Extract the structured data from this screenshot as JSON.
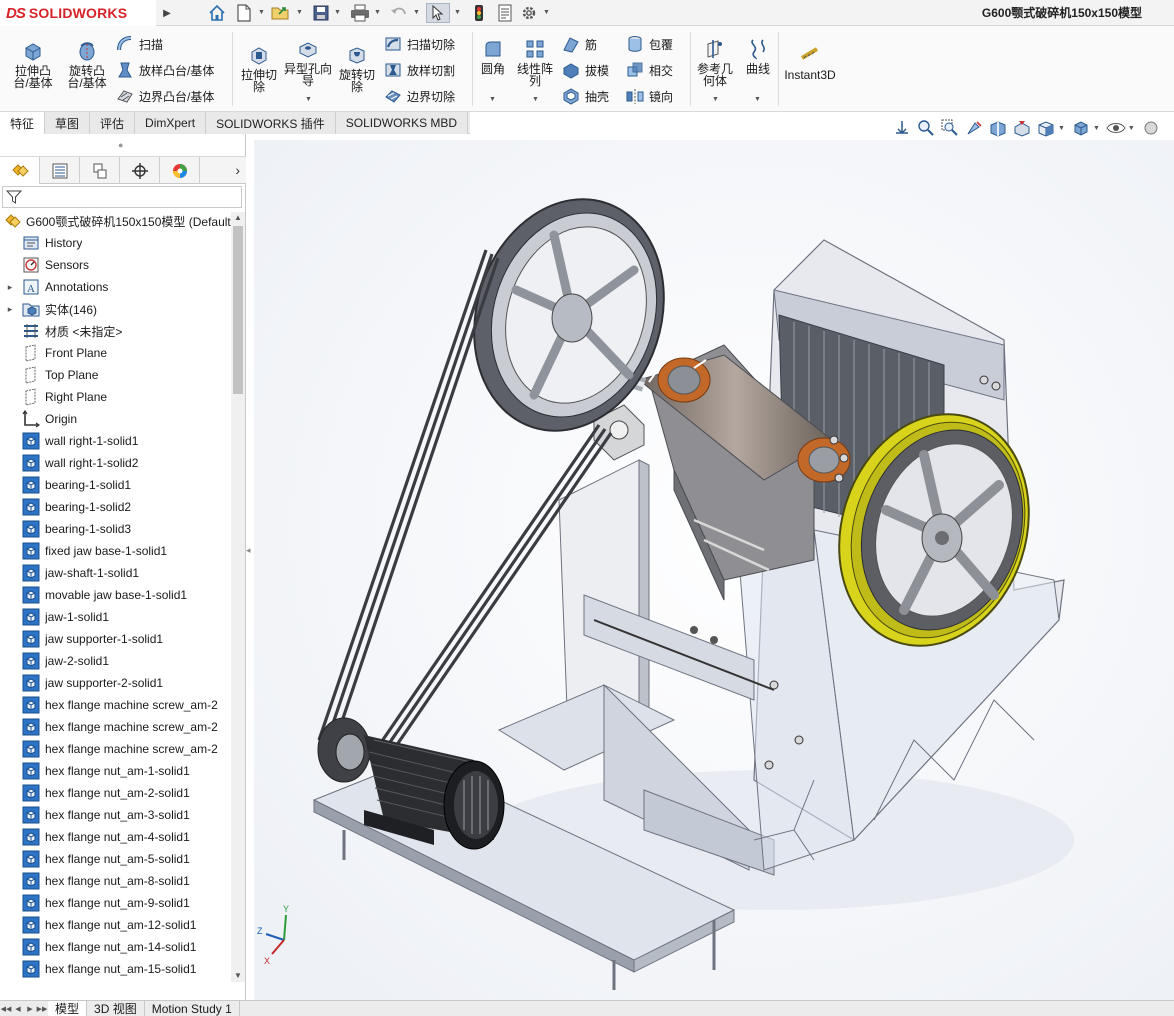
{
  "app": {
    "logo_ds": "DS",
    "logo_name": "SOLIDWORKS"
  },
  "document": {
    "title": "G600颚式破碎机150x150模型"
  },
  "quick_access": [
    "home-icon",
    "new-doc-icon",
    "open-icon",
    "save-icon",
    "print-icon",
    "undo-icon",
    "select-cursor-icon",
    "rebuild-traffic-light-icon",
    "file-properties-icon",
    "options-gear-icon"
  ],
  "ribbon": {
    "extrude_boss": "拉伸凸台/基体",
    "revolve_boss": "旋转凸台/基体",
    "sweep": "扫描",
    "loft_boss": "放样凸台/基体",
    "boundary_boss": "边界凸台/基体",
    "extrude_cut": "拉伸切除",
    "hole_wizard": "异型孔向导",
    "revolve_cut": "旋转切除",
    "swept_cut": "扫描切除",
    "lofted_cut": "放样切割",
    "boundary_cut": "边界切除",
    "fillet": "圆角",
    "linear_pattern": "线性阵列",
    "rib": "筋",
    "draft": "拔模",
    "shell": "抽壳",
    "wrap": "包覆",
    "intersect": "相交",
    "mirror": "镜向",
    "ref_geometry": "参考几何体",
    "curves": "曲线",
    "instant3d": "Instant3D"
  },
  "tabs": [
    {
      "label": "特征",
      "active": true
    },
    {
      "label": "草图",
      "active": false
    },
    {
      "label": "评估",
      "active": false
    },
    {
      "label": "DimXpert",
      "active": false
    },
    {
      "label": "SOLIDWORKS 插件",
      "active": false
    },
    {
      "label": "SOLIDWORKS MBD",
      "active": false
    }
  ],
  "tree": {
    "root": "G600颚式破碎机150x150模型  (Default",
    "items": [
      {
        "label": "History",
        "icon": "history-icon",
        "exp": ""
      },
      {
        "label": "Sensors",
        "icon": "sensors-icon",
        "exp": ""
      },
      {
        "label": "Annotations",
        "icon": "annotations-icon",
        "exp": "▸"
      },
      {
        "label": "实体(146)",
        "icon": "solid-bodies-folder-icon",
        "exp": "▸"
      },
      {
        "label": "材质 <未指定>",
        "icon": "material-icon",
        "exp": ""
      },
      {
        "label": "Front Plane",
        "icon": "plane-icon",
        "exp": ""
      },
      {
        "label": "Top Plane",
        "icon": "plane-icon",
        "exp": ""
      },
      {
        "label": "Right Plane",
        "icon": "plane-icon",
        "exp": ""
      },
      {
        "label": "Origin",
        "icon": "origin-icon",
        "exp": ""
      },
      {
        "label": "wall right-1-solid1",
        "icon": "solid-body-icon",
        "exp": ""
      },
      {
        "label": "wall right-1-solid2",
        "icon": "solid-body-icon",
        "exp": ""
      },
      {
        "label": "bearing-1-solid1",
        "icon": "solid-body-icon",
        "exp": ""
      },
      {
        "label": "bearing-1-solid2",
        "icon": "solid-body-icon",
        "exp": ""
      },
      {
        "label": "bearing-1-solid3",
        "icon": "solid-body-icon",
        "exp": ""
      },
      {
        "label": "fixed jaw base-1-solid1",
        "icon": "solid-body-icon",
        "exp": ""
      },
      {
        "label": "jaw-shaft-1-solid1",
        "icon": "solid-body-icon",
        "exp": ""
      },
      {
        "label": "movable jaw base-1-solid1",
        "icon": "solid-body-icon",
        "exp": ""
      },
      {
        "label": "jaw-1-solid1",
        "icon": "solid-body-icon",
        "exp": ""
      },
      {
        "label": "jaw supporter-1-solid1",
        "icon": "solid-body-icon",
        "exp": ""
      },
      {
        "label": "jaw-2-solid1",
        "icon": "solid-body-icon",
        "exp": ""
      },
      {
        "label": "jaw supporter-2-solid1",
        "icon": "solid-body-icon",
        "exp": ""
      },
      {
        "label": "hex flange machine screw_am-2",
        "icon": "solid-body-icon",
        "exp": ""
      },
      {
        "label": "hex flange machine screw_am-2",
        "icon": "solid-body-icon",
        "exp": ""
      },
      {
        "label": "hex flange machine screw_am-2",
        "icon": "solid-body-icon",
        "exp": ""
      },
      {
        "label": "hex flange nut_am-1-solid1",
        "icon": "solid-body-icon",
        "exp": ""
      },
      {
        "label": "hex flange nut_am-2-solid1",
        "icon": "solid-body-icon",
        "exp": ""
      },
      {
        "label": "hex flange nut_am-3-solid1",
        "icon": "solid-body-icon",
        "exp": ""
      },
      {
        "label": "hex flange nut_am-4-solid1",
        "icon": "solid-body-icon",
        "exp": ""
      },
      {
        "label": "hex flange nut_am-5-solid1",
        "icon": "solid-body-icon",
        "exp": ""
      },
      {
        "label": "hex flange nut_am-8-solid1",
        "icon": "solid-body-icon",
        "exp": ""
      },
      {
        "label": "hex flange nut_am-9-solid1",
        "icon": "solid-body-icon",
        "exp": ""
      },
      {
        "label": "hex flange nut_am-12-solid1",
        "icon": "solid-body-icon",
        "exp": ""
      },
      {
        "label": "hex flange nut_am-14-solid1",
        "icon": "solid-body-icon",
        "exp": ""
      },
      {
        "label": "hex flange nut_am-15-solid1",
        "icon": "solid-body-icon",
        "exp": ""
      }
    ]
  },
  "bottom_tabs": [
    {
      "label": "模型",
      "active": true
    },
    {
      "label": "3D 视图",
      "active": false
    },
    {
      "label": "Motion Study 1",
      "active": false
    }
  ],
  "triad": {
    "x": "X",
    "y": "Y",
    "z": "Z"
  },
  "colors": {
    "brand_red": "#d8232a",
    "part_grey": "#8a8f9a",
    "belt_yellow": "#d8d41c",
    "bronze": "#c2692a"
  }
}
